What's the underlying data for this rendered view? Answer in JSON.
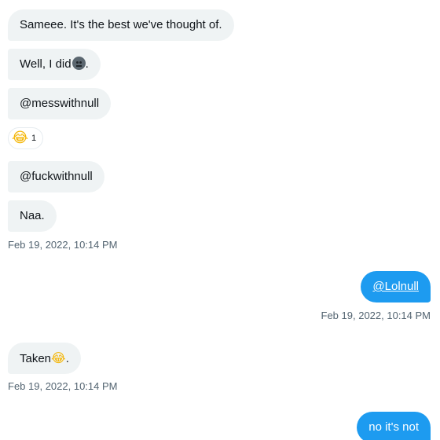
{
  "messages": [
    {
      "text": "Sameee. It's the best we've thought of."
    },
    {
      "text_before": "Well, I did",
      "emoji": "neutral-face-icon",
      "text_after": "."
    },
    {
      "text": "@messwithnull"
    },
    {
      "text": "@fuckwithnull"
    },
    {
      "text": "Naa."
    },
    {
      "text": "@Lolnull"
    },
    {
      "text_before": "Taken",
      "emoji_char": "😂",
      "text_after": "."
    },
    {
      "text": "no it's not"
    }
  ],
  "reaction": {
    "emoji": "😂",
    "count": "1"
  },
  "timestamps": [
    "Feb 19, 2022, 10:14 PM",
    "Feb 19, 2022, 10:14 PM",
    "Feb 19, 2022, 10:14 PM"
  ],
  "colors": {
    "incoming_bg": "#eff3f4",
    "outgoing_bg": "#1d9bf0",
    "timestamp": "#536471"
  }
}
